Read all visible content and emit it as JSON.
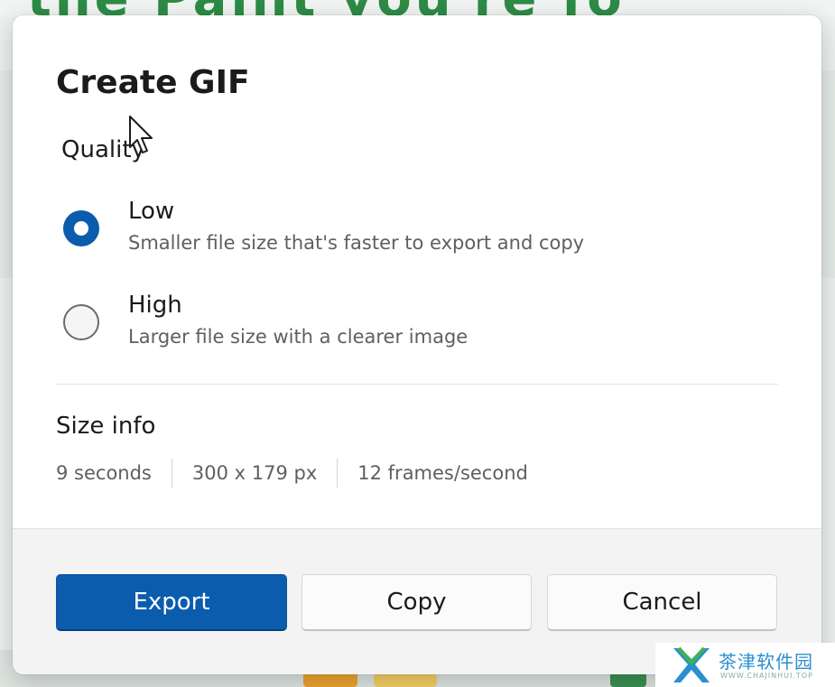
{
  "background": {
    "title_fragment": "the Paint you're fo"
  },
  "dialog": {
    "title": "Create GIF",
    "quality_label": "Quality",
    "options": [
      {
        "label": "Low",
        "description": "Smaller file size that's faster to export and copy",
        "selected": true
      },
      {
        "label": "High",
        "description": "Larger file size with a clearer image",
        "selected": false
      }
    ],
    "size_info": {
      "heading": "Size info",
      "duration": "9 seconds",
      "dimensions": "300 x 179 px",
      "frame_rate": "12 frames/second"
    },
    "buttons": {
      "export": "Export",
      "copy": "Copy",
      "cancel": "Cancel"
    }
  },
  "watermark": {
    "text": "茶津软件园",
    "subtext": "WWW.CHAJINHUI.TOP"
  },
  "colors": {
    "accent": "#0b5cad",
    "text_primary": "#1b1b1b",
    "text_secondary": "#5f5f5f",
    "footer_bg": "#f3f3f3"
  }
}
